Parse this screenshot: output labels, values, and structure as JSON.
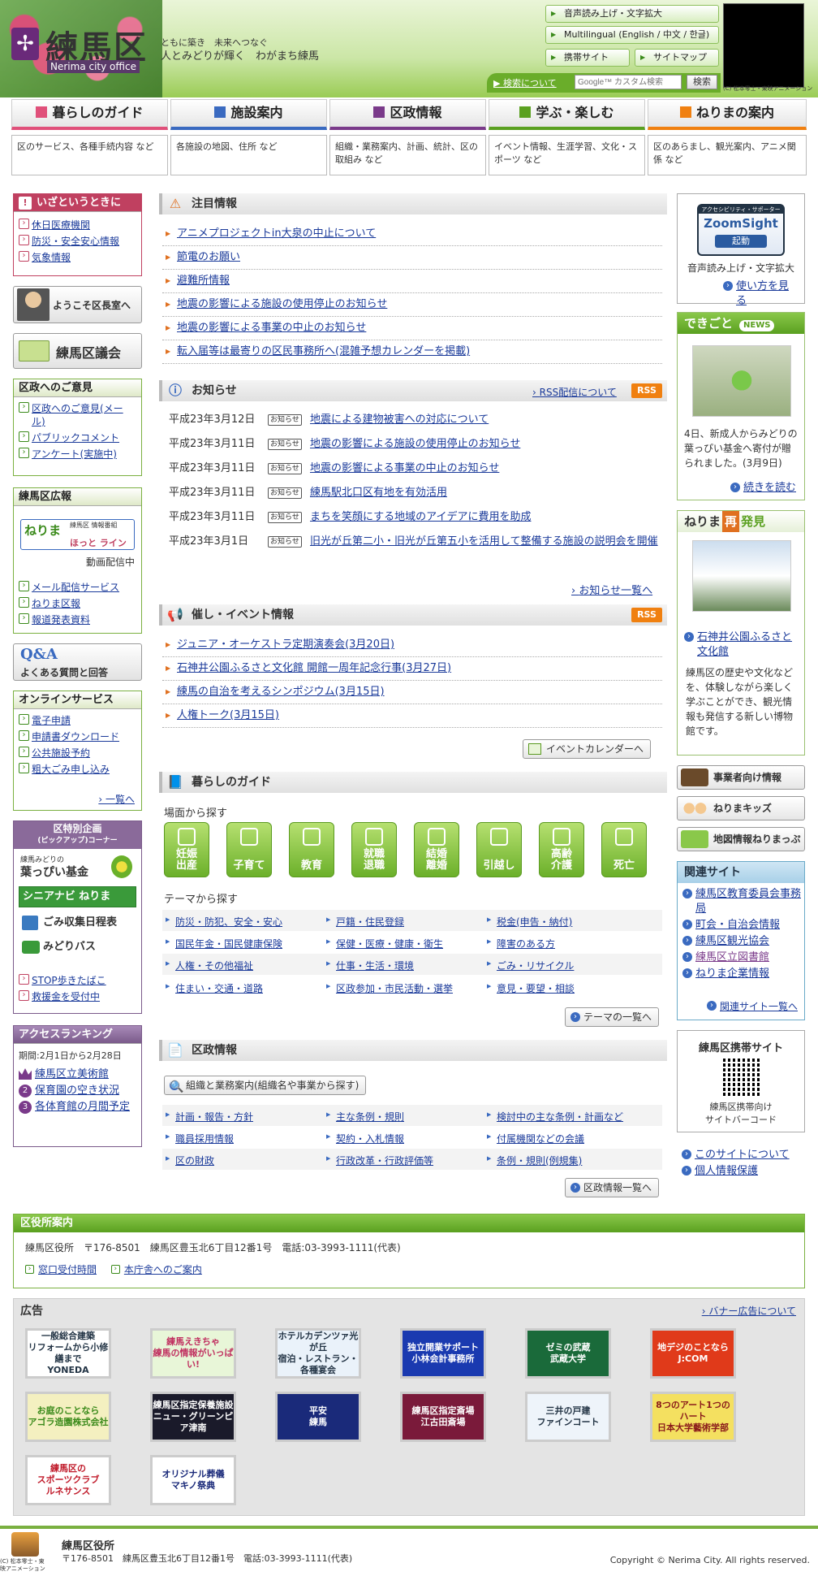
{
  "header": {
    "logo_name": "練馬区",
    "logo_en": "Nerima city office",
    "tagline1": "ともに築き　未来へつなぐ",
    "tagline2": "人とみどりが輝く　わがまち練馬",
    "btn_speech": "音声読み上げ・文字拡大",
    "btn_multilingual": "Multilingual (English / 中文 / 한글)",
    "btn_mobile": "携帯サイト",
    "btn_sitemap": "サイトマップ",
    "search_about": "検索について",
    "search_placeholder": "Google™ カスタム検索",
    "search_btn": "検索",
    "video_caption": "(C) 松本零士・東映アニメーション"
  },
  "nav": [
    {
      "label": "暮らしのガイド",
      "desc": "区のサービス、各種手続内容 など",
      "color": "#e0507a"
    },
    {
      "label": "施設案内",
      "desc": "各施設の地図、住所 など",
      "color": "#3a6ac0"
    },
    {
      "label": "区政情報",
      "desc": "組織・業務案内、計画、統計、区の取組み など",
      "color": "#7a3a8a"
    },
    {
      "label": "学ぶ・楽しむ",
      "desc": "イベント情報、生涯学習、文化・スポーツ など",
      "color": "#5aa020"
    },
    {
      "label": "ねりまの案内",
      "desc": "区のあらまし、観光案内、アニメ関係 など",
      "color": "#f08010"
    }
  ],
  "left": {
    "emergency": {
      "title": "いざというときに",
      "items": [
        "休日医療機関",
        "防災・安全安心情報",
        "気象情報"
      ]
    },
    "mayor": "ようこそ区長室へ",
    "council": "練馬区議会",
    "opinion": {
      "title": "区政へのご意見",
      "items": [
        "区政へのご意見(メール)",
        "パブリックコメント",
        "アンケート(実施中)"
      ]
    },
    "pr": {
      "title": "練馬区広報",
      "banner1": "ねりま",
      "banner2": "ほっと ライン",
      "banner_sub": "練馬区 情報番組",
      "video": "動画配信中",
      "items": [
        "メール配信サービス",
        "ねりま区報",
        "報道発表資料"
      ]
    },
    "qa": {
      "a": "Q&A",
      "b": "よくある質問と回答"
    },
    "online": {
      "title": "オンラインサービス",
      "items": [
        "電子申請",
        "申請書ダウンロード",
        "公共施設予約",
        "粗大ごみ申し込み"
      ],
      "more": "一覧へ"
    },
    "pickup": {
      "title1": "区特別企画",
      "title2": "(ピックアップ)コーナー",
      "fund_pre": "練馬みどりの",
      "fund": "葉っぴい基金",
      "senior": "シニアナビ ねりま",
      "garbage": "ごみ収集日程表",
      "bus": "みどりバス",
      "items": [
        "STOP歩きたばこ",
        "救援金を受付中"
      ]
    },
    "ranking": {
      "title": "アクセスランキング",
      "period": "期間:2月1日から2月28日",
      "items": [
        "練馬区立美術館",
        "保育園の空き状況",
        "各体育館の月間予定"
      ]
    }
  },
  "main": {
    "attention": {
      "title": "注目情報",
      "items": [
        "アニメプロジェクトin大泉の中止について",
        "節電のお願い",
        "避難所情報",
        "地震の影響による施設の使用停止のお知らせ",
        "地震の影響による事業の中止のお知らせ",
        "転入届等は最寄りの区民事務所へ(混雑予想カレンダーを掲載)"
      ]
    },
    "news": {
      "title": "お知らせ",
      "rss_about": "RSS配信について",
      "rss": "RSS",
      "badge": "お知らせ",
      "items": [
        {
          "date": "平成23年3月12日",
          "text": "地震による建物被害への対応について"
        },
        {
          "date": "平成23年3月11日",
          "text": "地震の影響による施設の使用停止のお知らせ"
        },
        {
          "date": "平成23年3月11日",
          "text": "地震の影響による事業の中止のお知らせ"
        },
        {
          "date": "平成23年3月11日",
          "text": "練馬駅北口区有地を有効活用"
        },
        {
          "date": "平成23年3月11日",
          "text": "まちを笑顔にする地域のアイデアに費用を助成"
        },
        {
          "date": "平成23年3月1日",
          "text": "旧光が丘第二小・旧光が丘第五小を活用して整備する施設の説明会を開催"
        }
      ],
      "more": "お知らせ一覧へ"
    },
    "events": {
      "title": "催し・イベント情報",
      "rss": "RSS",
      "items": [
        "ジュニア・オーケストラ定期演奏会(3月20日)",
        "石神井公園ふるさと文化館 開館一周年記念行事(3月27日)",
        "練馬の自治を考えるシンポジウム(3月15日)",
        "人権トーク(3月15日)"
      ],
      "calendar": "イベントカレンダーへ"
    },
    "guide": {
      "title": "暮らしのガイド",
      "scene_label": "場面から探す",
      "scenes": [
        "妊娠\n出産",
        "子育て",
        "教育",
        "就職\n退職",
        "結婚\n離婚",
        "引越し",
        "高齢\n介護",
        "死亡"
      ],
      "theme_label": "テーマから探す",
      "themes": [
        [
          "防災・防犯、安全・安心",
          "戸籍・住民登録",
          "税金(申告・納付)"
        ],
        [
          "国民年金・国民健康保険",
          "保健・医療・健康・衛生",
          "障害のある方"
        ],
        [
          "人権・その他福祉",
          "仕事・生活・環境",
          "ごみ・リサイクル"
        ],
        [
          "住まい・交通・道路",
          "区政参加・市民活動・選挙",
          "意見・要望・相談"
        ]
      ],
      "more": "テーマの一覧へ"
    },
    "admin": {
      "title": "区政情報",
      "search_btn": "組織と業務案内(組織名や事業から探す)",
      "items": [
        [
          "計画・報告・方針",
          "主な条例・規則",
          "検討中の主な条例・計画など"
        ],
        [
          "職員採用情報",
          "契約・入札情報",
          "付属機関などの会議"
        ],
        [
          "区の財政",
          "行政改革・行政評価等",
          "条例・規則(例規集)"
        ]
      ],
      "more": "区政情報一覧へ"
    }
  },
  "right": {
    "zoom": {
      "label1": "アクセシビリティ・サポーター",
      "label2": "ZoomSight",
      "label3": "起動",
      "desc": "音声読み上げ・文字拡大",
      "link": "使い方を見る"
    },
    "dekigoto": {
      "title": "できごと",
      "badge": "NEWS",
      "text": "4日、新成人からみどりの葉っぴい基金へ寄付が贈られました。(3月9日)",
      "link": "続きを読む"
    },
    "rediscover": {
      "title1": "ねりま",
      "title2": "再",
      "title3": "発見",
      "link": "石神井公園ふるさと文化館",
      "text": "練馬区の歴史や文化などを、体験しながら楽しく学ぶことができ、観光情報も発信する新しい博物館です。"
    },
    "btns": [
      "事業者向け情報",
      "ねりまキッズ",
      "地図情報ねりまっぷ"
    ],
    "related": {
      "title": "関連サイト",
      "items": [
        "練馬区教育委員会事務局",
        "町会・自治会情報",
        "練馬区観光協会",
        "練馬区立図書館",
        "ねりま企業情報"
      ],
      "more": "関連サイト一覧へ"
    },
    "mobile": {
      "title": "練馬区携帯サイト",
      "caption1": "練馬区携帯向け",
      "caption2": "サイトバーコード"
    },
    "links": [
      "このサイトについて",
      "個人情報保護"
    ]
  },
  "office": {
    "title": "区役所案内",
    "address": "練馬区役所　〒176-8501　練馬区豊玉北6丁目12番1号　電話:03-3993-1111(代表)",
    "links": [
      "窓口受付時間",
      "本庁舎へのご案内"
    ]
  },
  "ads": {
    "title": "広告",
    "about": "バナー広告について",
    "items": [
      "一般総合建築\nリフォームから小修繕まで\nYONEDA",
      "練馬えきちゃ\n練馬の情報がいっぱい!",
      "ホテルカデンツァ光が丘\n宿泊・レストラン・各種宴会",
      "独立開業サポート\n小林会計事務所",
      "ゼミの武蔵\n武蔵大学",
      "地デジのことなら\nJ:COM",
      "お庭のことなら\nアゴラ造園株式会社",
      "練馬区指定保養施設\nニュー・グリーンピア津南",
      "平安\n練馬",
      "練馬区指定斎場\n江古田斎場",
      "三井の戸建\nファインコート",
      "8つのアート1つのハート\n日本大学藝術学部",
      "練馬区の\nスポーツクラブ\nルネサンス",
      "オリジナル葬儀\nマキノ祭典"
    ]
  },
  "footer": {
    "name": "練馬区役所",
    "address": "〒176-8501　練馬区豊玉北6丁目12番1号　電話:03-3993-1111(代表)",
    "copyright": "Copyright © Nerima City. All rights reserved.",
    "logo_caption": "(C) 松本零士・東映アニメーション"
  }
}
